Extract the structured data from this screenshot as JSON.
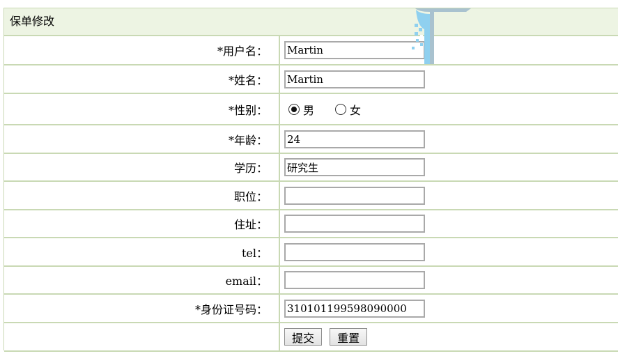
{
  "panel": {
    "title": "保单修改"
  },
  "form": {
    "username": {
      "label": "*用户名：",
      "value": "Martin"
    },
    "name": {
      "label": "*姓名：",
      "value": "Martin"
    },
    "gender": {
      "label": "*性别：",
      "options": [
        {
          "label": "男",
          "checked": true
        },
        {
          "label": "女",
          "checked": false
        }
      ]
    },
    "age": {
      "label": "*年龄：",
      "value": "24"
    },
    "education": {
      "label": "学历：",
      "value": "研究生"
    },
    "position": {
      "label": "职位：",
      "value": ""
    },
    "address": {
      "label": "住址：",
      "value": ""
    },
    "tel": {
      "label": "tel：",
      "value": ""
    },
    "email": {
      "label": "email：",
      "value": ""
    },
    "id_number": {
      "label": "*身份证号码：",
      "value": "310101199598090000"
    }
  },
  "buttons": {
    "submit": "提交",
    "reset": "重置"
  },
  "colors": {
    "header_bg": "#edf4e3",
    "border": "#c9d9b4"
  }
}
